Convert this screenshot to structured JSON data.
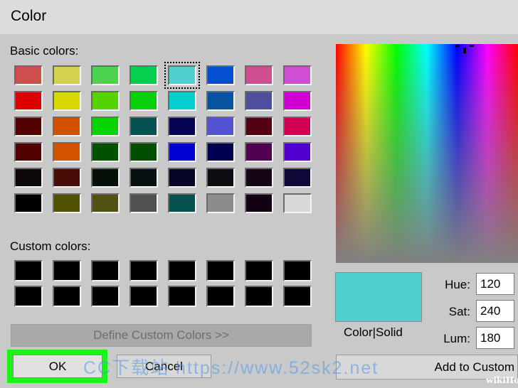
{
  "dialog": {
    "title": "Color"
  },
  "basic": {
    "label": "Basic colors:",
    "selected_index": 4,
    "colors": [
      "#d04d4e",
      "#d3d24e",
      "#4cd24e",
      "#05cf4e",
      "#4fd0cf",
      "#0550d2",
      "#d04e8f",
      "#d04ed1",
      "#dd0000",
      "#d8d800",
      "#55d300",
      "#06d10c",
      "#06cfd2",
      "#0653a0",
      "#4e4e9c",
      "#d000d2",
      "#520000",
      "#d35200",
      "#06d300",
      "#065252",
      "#040452",
      "#5252d2",
      "#520012",
      "#d20052",
      "#520000",
      "#d25400",
      "#005200",
      "#004f00",
      "#0000d0",
      "#000052",
      "#520052",
      "#5200d0",
      "#0c0606",
      "#4a0c06",
      "#061006",
      "#061010",
      "#040426",
      "#0c0c12",
      "#140614",
      "#100638",
      "#000000",
      "#505100",
      "#525114",
      "#505050",
      "#065251",
      "#8c8c8c",
      "#120012",
      "#d8d8d8"
    ]
  },
  "custom": {
    "label": "Custom colors:",
    "colors": [
      "#000000",
      "#000000",
      "#000000",
      "#000000",
      "#000000",
      "#000000",
      "#000000",
      "#000000",
      "#000000",
      "#000000",
      "#000000",
      "#000000",
      "#000000",
      "#000000",
      "#000000",
      "#000000"
    ]
  },
  "buttons": {
    "define": "Define Custom Colors >>",
    "ok": "OK",
    "cancel": "Cancel",
    "add": "Add to Custom"
  },
  "preview": {
    "label": "Color|Solid",
    "color": "#4fd0cf"
  },
  "fields": {
    "hue_label": "Hue:",
    "hue": "120",
    "sat_label": "Sat:",
    "sat": "240",
    "lum_label": "Lum:",
    "lum": "180"
  },
  "overlay": {
    "watermark": "CC下载站 https://www.52sk2.net",
    "brand": "wikiHow"
  }
}
